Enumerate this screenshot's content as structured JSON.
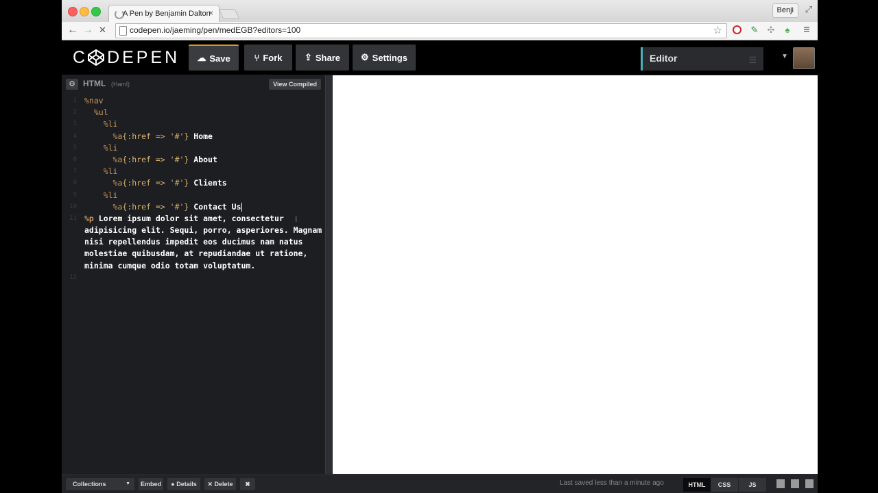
{
  "browser": {
    "tab_title": "A Pen by Benjamin Dalton",
    "tab_close": "×",
    "user_name": "Benji",
    "url": "codepen.io/jaeming/pen/medEGB?editors=100",
    "back_icon": "←",
    "forward_icon": "→",
    "stop_icon": "✕",
    "star_icon": "☆",
    "fullscreen_icon": "⤢",
    "menu_icon": "≡"
  },
  "header": {
    "logo_text_left": "C",
    "logo_text_right": "DEPEN",
    "buttons": {
      "save": "Save",
      "fork": "Fork",
      "share": "Share",
      "settings": "Settings"
    },
    "editor_select": "Editor",
    "dropdown_icon": "▼",
    "accent_color": "#d69a20",
    "editor_accent_color": "#4fb3bf"
  },
  "editor": {
    "title": "HTML",
    "subtitle": "(Haml)",
    "view_compiled": "View Compiled",
    "gear_icon": "⚙",
    "line_numbers": [
      "1",
      "2",
      "3",
      "4",
      "5",
      "6",
      "7",
      "8",
      "9",
      "10",
      "11",
      "",
      "",
      "",
      "",
      "12"
    ],
    "lines": [
      {
        "tag": "%nav",
        "attr": "",
        "text": "",
        "indent": ""
      },
      {
        "tag": "%ul",
        "attr": "",
        "text": "",
        "indent": "  "
      },
      {
        "tag": "%li",
        "attr": "",
        "text": "",
        "indent": "    "
      },
      {
        "tag": "%a",
        "attr": "{:href => '#'}",
        "text": " Home",
        "indent": "      "
      },
      {
        "tag": "%li",
        "attr": "",
        "text": "",
        "indent": "    "
      },
      {
        "tag": "%a",
        "attr": "{:href => '#'}",
        "text": " About",
        "indent": "      "
      },
      {
        "tag": "%li",
        "attr": "",
        "text": "",
        "indent": "    "
      },
      {
        "tag": "%a",
        "attr": "{:href => '#'}",
        "text": " Clients",
        "indent": "      "
      },
      {
        "tag": "%li",
        "attr": "",
        "text": "",
        "indent": "    "
      },
      {
        "tag": "%a",
        "attr": "{:href => '#'}",
        "text": " Contact Us",
        "indent": "      "
      }
    ],
    "paragraph_tag": "%p",
    "paragraph_text": "Lorem ipsum dolor sit amet, consectetur adipisicing elit. Sequi, porro, asperiores. Magnam nisi repellendus impedit eos ducimus nam natus molestiae quibusdam, at repudiandae ut ratione, minima cumque odio totam voluptatum."
  },
  "footer": {
    "collections": "Collections",
    "collections_caret": "▼",
    "embed": "Embed",
    "details": "Details",
    "delete": "Delete",
    "close_icon": "✖",
    "status": "Last saved less than a minute ago",
    "tabs": [
      "HTML",
      "CSS",
      "JS"
    ]
  }
}
